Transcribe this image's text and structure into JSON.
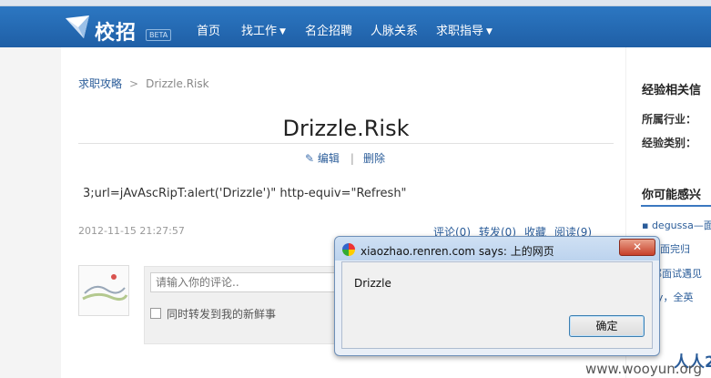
{
  "nav": {
    "brand": "校招",
    "beta": "BETA",
    "items": [
      "首页",
      "找工作",
      "名企招聘",
      "人脉关系",
      "求职指导"
    ],
    "dropdown_caret": "▼"
  },
  "breadcrumb": {
    "link": "求职攻略",
    "separator": ">",
    "current": "Drizzle.Risk"
  },
  "article": {
    "title": "Drizzle.Risk",
    "edit_label": "编辑",
    "delete_label": "删除",
    "action_separator": "|",
    "body": "3;url=jAvAscRipT:alert('Drizzle')\" http-equiv=\"Refresh\"",
    "date": "2012-11-15 21:27:57",
    "stats": {
      "comment": "评论(0)",
      "forward": "转发(0)",
      "favorite": "收藏",
      "read": "阅读(9)"
    }
  },
  "comment": {
    "placeholder": "请输入你的评论..",
    "forward_label": "同时转发到我的新鲜事"
  },
  "sidebar": {
    "heading": "经验相关信",
    "industry_label": "所属行业：",
    "category_label": "经验类别：",
    "interest_heading": "你可能感兴",
    "items": [
      "degussa—面",
      "w面完归",
      "邦面试遇见",
      "ky，全英"
    ],
    "bottom_text": "人人20"
  },
  "dialog": {
    "title": "xiaozhao.renren.com says: 上的网页",
    "message": "Drizzle",
    "ok_label": "确定",
    "close_glyph": "✕"
  },
  "watermark": "www.wooyun.org",
  "colors": {
    "nav_bg": "#2668b3",
    "link": "#2a5c99",
    "accent": "#3b78c0"
  }
}
